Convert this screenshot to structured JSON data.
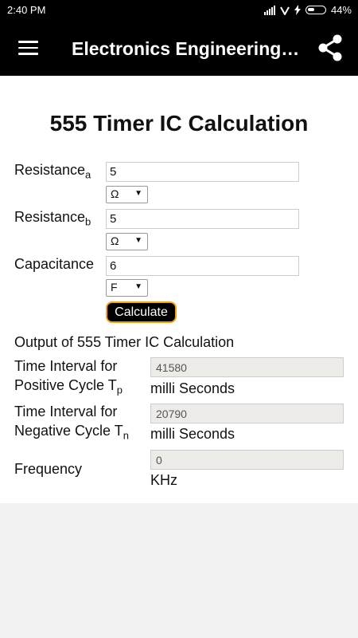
{
  "status_bar": {
    "time": "2:40 PM",
    "battery": "44%"
  },
  "app_bar": {
    "title": "Electronics Engineering…",
    "menu_icon": "hamburger-menu-icon",
    "share_icon": "share-icon"
  },
  "page": {
    "title": "555 Timer IC Calculation"
  },
  "form": {
    "resistance_a": {
      "label": "Resistance",
      "sub": "a",
      "value": "5",
      "unit": "Ω"
    },
    "resistance_b": {
      "label": "Resistance",
      "sub": "b",
      "value": "5",
      "unit": "Ω"
    },
    "capacitance": {
      "label": "Capacitance",
      "value": "6",
      "unit": "F"
    },
    "calculate_label": "Calculate"
  },
  "output": {
    "title": "Output of 555 Timer IC Calculation",
    "positive": {
      "label_line1": "Time Interval for",
      "label_line2": "Positive Cycle T",
      "sub": "p",
      "value": "41580",
      "unit": "milli Seconds"
    },
    "negative": {
      "label_line1": "Time Interval for",
      "label_line2": "Negative Cycle T",
      "sub": "n",
      "value": "20790",
      "unit": "milli Seconds"
    },
    "frequency": {
      "label": "Frequency",
      "value": "0",
      "unit": "KHz"
    }
  }
}
